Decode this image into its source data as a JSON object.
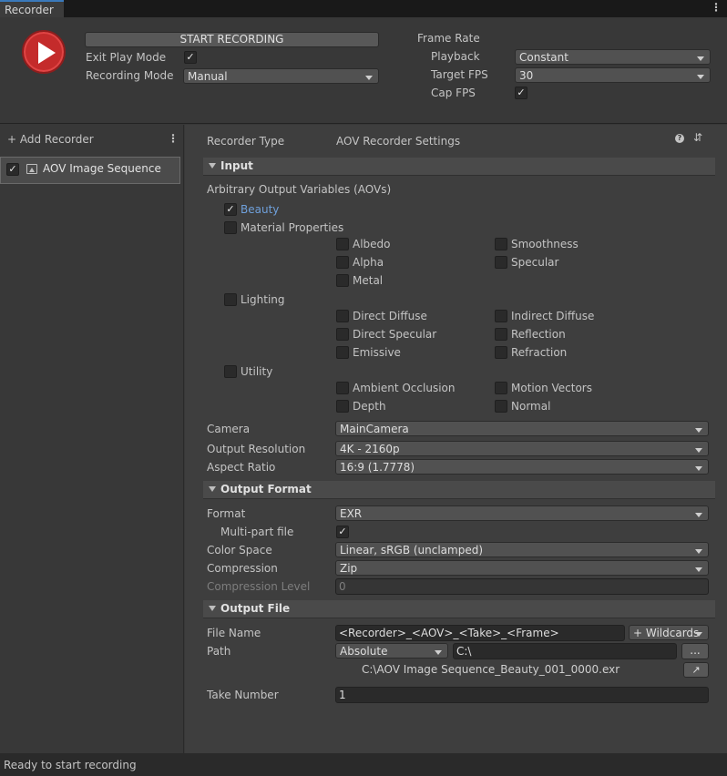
{
  "window": {
    "tab": "Recorder",
    "menu_icon": "kebab-icon"
  },
  "top": {
    "start_recording": "START RECORDING",
    "exit_play_mode": {
      "label": "Exit Play Mode",
      "checked": true
    },
    "recording_mode": {
      "label": "Recording Mode",
      "value": "Manual"
    },
    "frame_rate": {
      "label": "Frame Rate"
    },
    "playback": {
      "label": "Playback",
      "value": "Constant"
    },
    "target_fps": {
      "label": "Target FPS",
      "value": "30"
    },
    "cap_fps": {
      "label": "Cap FPS",
      "checked": true
    }
  },
  "left": {
    "add_recorder": "+ Add Recorder",
    "items": [
      {
        "label": "AOV Image Sequence",
        "checked": true
      }
    ]
  },
  "settings": {
    "recorder_type": {
      "label": "Recorder Type",
      "value": "AOV Recorder Settings"
    },
    "input": {
      "title": "Input",
      "aovs_label": "Arbitrary Output Variables (AOVs)",
      "beauty": "Beauty",
      "material_properties": "Material Properties",
      "albedo": "Albedo",
      "smoothness": "Smoothness",
      "alpha": "Alpha",
      "specular": "Specular",
      "metal": "Metal",
      "lighting": "Lighting",
      "direct_diffuse": "Direct Diffuse",
      "indirect_diffuse": "Indirect Diffuse",
      "direct_specular": "Direct Specular",
      "reflection": "Reflection",
      "emissive": "Emissive",
      "refraction": "Refraction",
      "utility": "Utility",
      "ambient_occlusion": "Ambient Occlusion",
      "motion_vectors": "Motion Vectors",
      "depth": "Depth",
      "normal": "Normal",
      "camera": {
        "label": "Camera",
        "value": "MainCamera"
      },
      "output_resolution": {
        "label": "Output Resolution",
        "value": "4K - 2160p"
      },
      "aspect_ratio": {
        "label": "Aspect Ratio",
        "value": "16:9 (1.7778)"
      }
    },
    "output_format": {
      "title": "Output Format",
      "format": {
        "label": "Format",
        "value": "EXR"
      },
      "multipart": {
        "label": "Multi-part file",
        "checked": true
      },
      "color_space": {
        "label": "Color Space",
        "value": "Linear, sRGB (unclamped)"
      },
      "compression": {
        "label": "Compression",
        "value": "Zip"
      },
      "compression_level": {
        "label": "Compression Level",
        "value": "0"
      }
    },
    "output_file": {
      "title": "Output File",
      "file_name": {
        "label": "File Name",
        "value": "<Recorder>_<AOV>_<Take>_<Frame>"
      },
      "wildcards": "+ Wildcards",
      "path": {
        "label": "Path",
        "mode": "Absolute",
        "value": "C:\\",
        "browse": "..."
      },
      "preview": "C:\\AOV Image Sequence_Beauty_001_0000.exr",
      "take_number": {
        "label": "Take Number",
        "value": "1"
      }
    }
  },
  "status": "Ready to start recording",
  "colors": {
    "accent": "#3a79bb",
    "record": "#c42b2b",
    "link": "#6fa0db"
  }
}
